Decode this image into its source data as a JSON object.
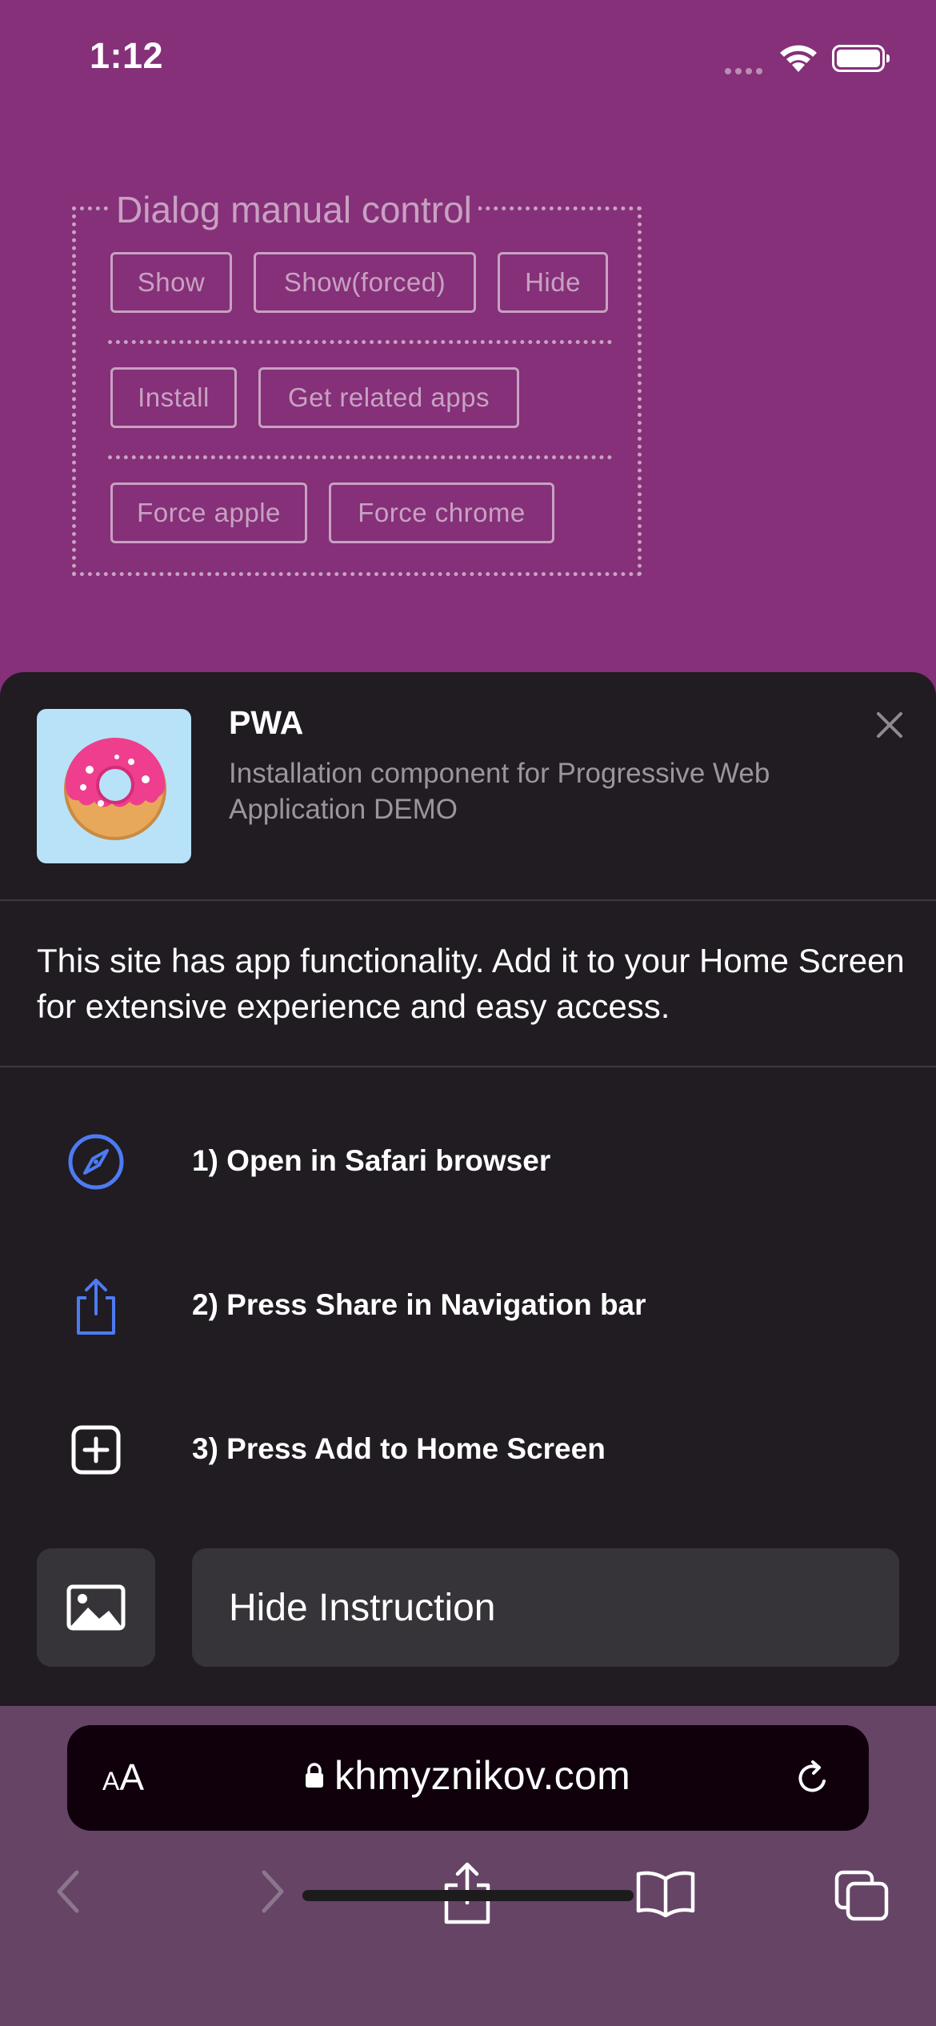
{
  "status_bar": {
    "time": "1:12"
  },
  "dialog_control": {
    "legend": "Dialog manual control",
    "row1": [
      "Show",
      "Show(forced)",
      "Hide"
    ],
    "row2": [
      "Install",
      "Get related apps"
    ],
    "row3": [
      "Force apple",
      "Force chrome"
    ]
  },
  "sheet": {
    "app_name": "PWA",
    "app_description": "Installation component for Progressive Web Application DEMO",
    "message": "This site has app functionality. Add it to your Home Screen for extensive experience and easy access.",
    "steps": [
      {
        "icon": "compass-icon",
        "text": "1) Open in Safari browser"
      },
      {
        "icon": "share-icon",
        "text": "2) Press Share in Navigation bar"
      },
      {
        "icon": "add-square-icon",
        "text": "3) Press Add to Home Screen"
      }
    ],
    "hide_button_label": "Hide Instruction"
  },
  "browser": {
    "text_size_label_small": "A",
    "text_size_label_large": "A",
    "url": "khmyznikov.com"
  },
  "colors": {
    "page_background": "#853079",
    "sheet_background": "#201c22",
    "icon_accent": "#4d7bf3",
    "button_background": "#363438"
  }
}
